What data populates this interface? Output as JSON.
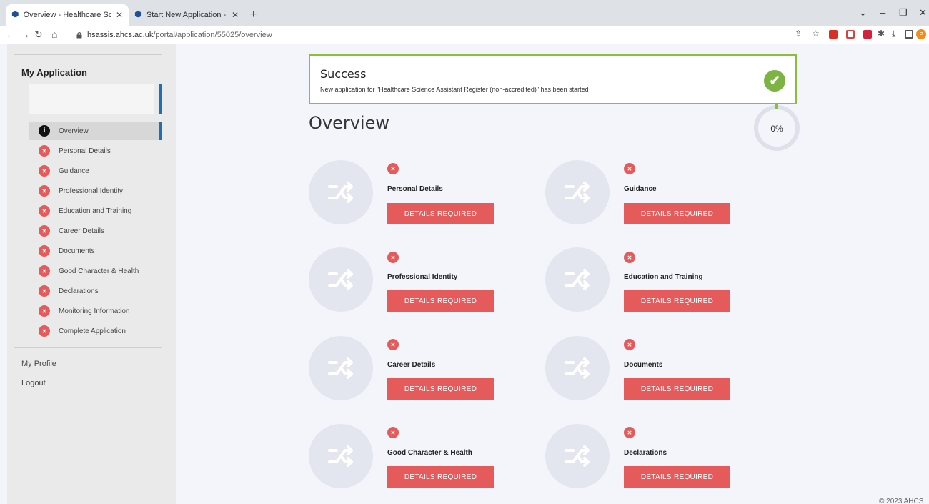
{
  "browser": {
    "tabs": [
      {
        "title": "Overview - Healthcare Science Ac",
        "active": true
      },
      {
        "title": "Start New Application - Applicat",
        "active": false
      }
    ],
    "new_tab_symbol": "+",
    "url_domain": "hsassis.ahcs.ac.uk",
    "url_path": "/portal/application/55025/overview",
    "profile_initial": "P"
  },
  "sidebar": {
    "title": "My Application",
    "items": [
      {
        "label": "Overview",
        "status": "info"
      },
      {
        "label": "Personal Details",
        "status": "error"
      },
      {
        "label": "Guidance",
        "status": "error"
      },
      {
        "label": "Professional Identity",
        "status": "error"
      },
      {
        "label": "Education and Training",
        "status": "error"
      },
      {
        "label": "Career Details",
        "status": "error"
      },
      {
        "label": "Documents",
        "status": "error"
      },
      {
        "label": "Good Character & Health",
        "status": "error"
      },
      {
        "label": "Declarations",
        "status": "error"
      },
      {
        "label": "Monitoring Information",
        "status": "error"
      },
      {
        "label": "Complete Application",
        "status": "error"
      }
    ],
    "links": [
      "My Profile",
      "Logout"
    ]
  },
  "alert": {
    "title": "Success",
    "message": "New application for \"Healthcare Science Assistant Register (non-accredited)\" has been started"
  },
  "page_title": "Overview",
  "progress": {
    "label": "0%",
    "value": 0
  },
  "cards": [
    {
      "title": "Personal Details",
      "button": "DETAILS REQUIRED"
    },
    {
      "title": "Guidance",
      "button": "DETAILS REQUIRED"
    },
    {
      "title": "Professional Identity",
      "button": "DETAILS REQUIRED"
    },
    {
      "title": "Education and Training",
      "button": "DETAILS REQUIRED"
    },
    {
      "title": "Career Details",
      "button": "DETAILS REQUIRED"
    },
    {
      "title": "Documents",
      "button": "DETAILS REQUIRED"
    },
    {
      "title": "Good Character & Health",
      "button": "DETAILS REQUIRED"
    },
    {
      "title": "Declarations",
      "button": "DETAILS REQUIRED"
    }
  ],
  "footer": "© 2023 AHCS",
  "colors": {
    "error": "#e55a5a",
    "success_border": "#8bbe3a",
    "success_icon": "#7cb342",
    "accent_blue": "#1f6fb5"
  }
}
